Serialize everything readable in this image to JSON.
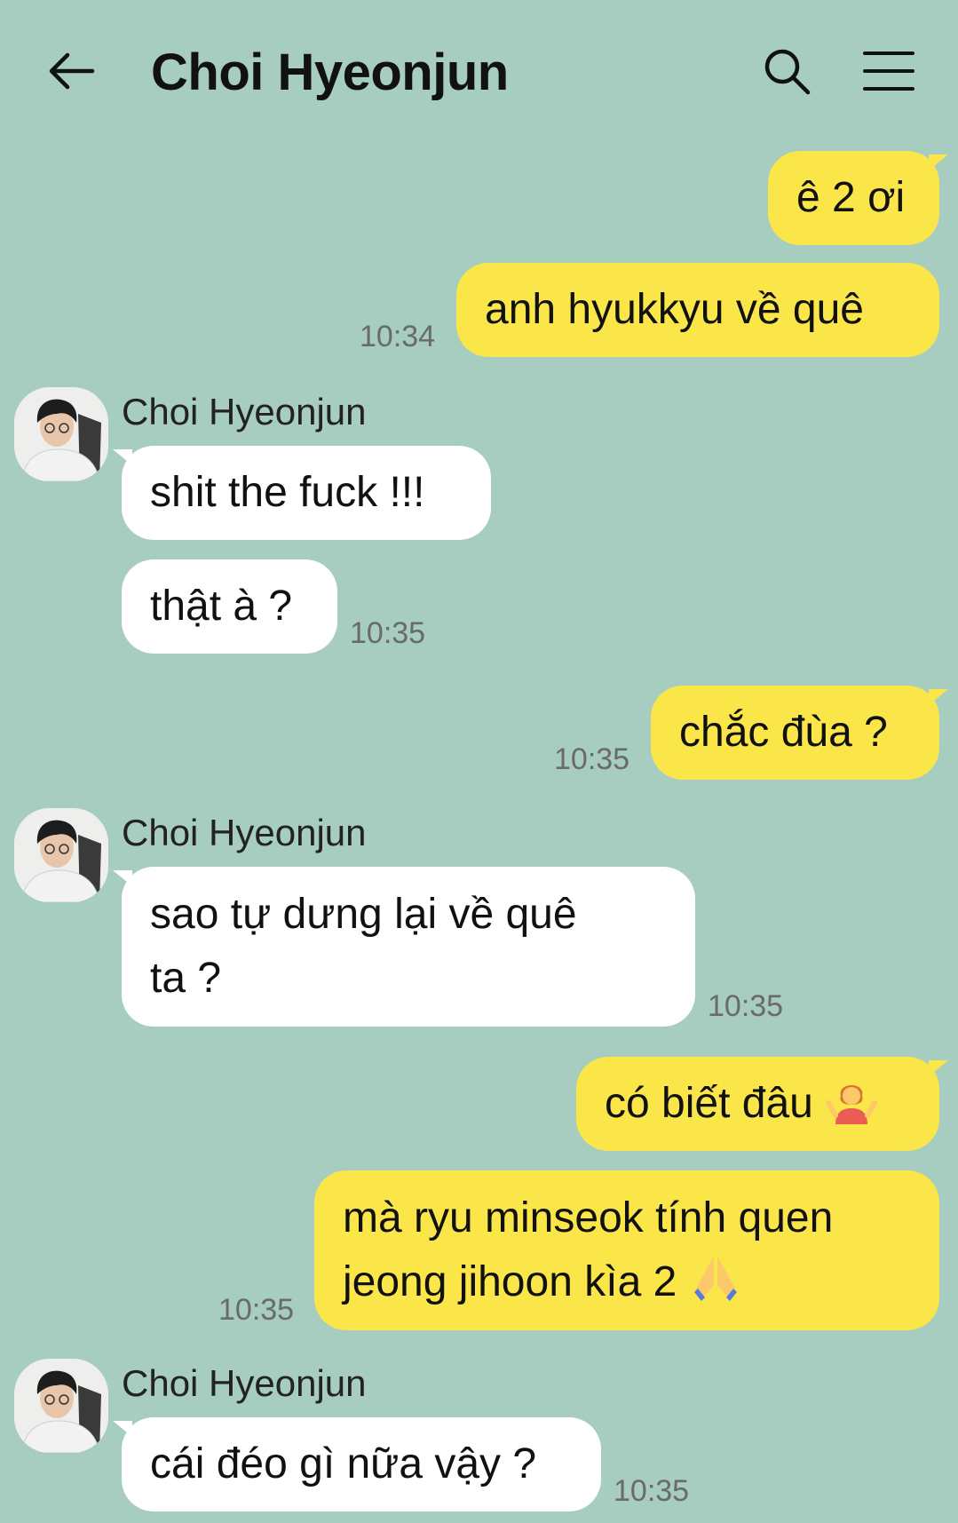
{
  "header": {
    "title": "Choi Hyeonjun",
    "icons": [
      "back-arrow-icon",
      "search-icon",
      "menu-icon"
    ]
  },
  "colors": {
    "background": "#a6cdbf",
    "outgoing_bubble": "#fbe64a",
    "incoming_bubble": "#ffffff",
    "timestamp": "#6a6a6a"
  },
  "messages": [
    {
      "direction": "out",
      "text": "ê 2 ơi"
    },
    {
      "direction": "out",
      "text": "anh hyukkyu về quê",
      "time": "10:34"
    },
    {
      "direction": "in",
      "sender": "Choi Hyeonjun",
      "text": "shit the fuck !!!"
    },
    {
      "direction": "in",
      "text": "thật à ?",
      "time": "10:35"
    },
    {
      "direction": "out",
      "text": "chắc đùa ?",
      "time": "10:35"
    },
    {
      "direction": "in",
      "sender": "Choi Hyeonjun",
      "lines": [
        "sao tự dưng lại về quê",
        "ta ?"
      ],
      "time": "10:35"
    },
    {
      "direction": "out",
      "text": "có biết đâu",
      "emoji": "person-shrugging-icon"
    },
    {
      "direction": "out",
      "lines": [
        "mà ryu minseok tính quen",
        "jeong jihoon kìa 2"
      ],
      "emoji": "folded-hands-icon",
      "time": "10:35"
    },
    {
      "direction": "in",
      "sender": "Choi Hyeonjun",
      "text": "cái đéo gì nữa vậy ?",
      "time": "10:35"
    }
  ]
}
